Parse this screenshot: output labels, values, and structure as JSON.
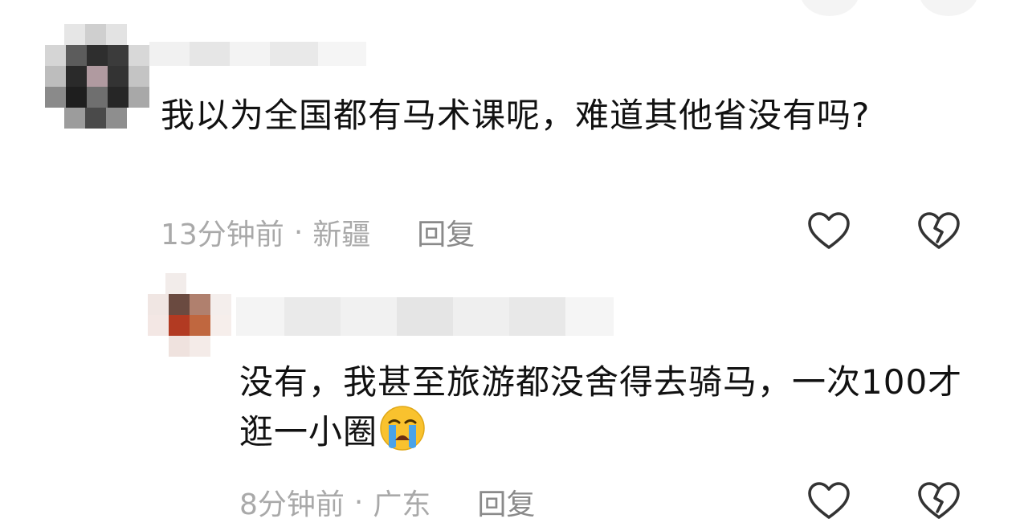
{
  "comments": [
    {
      "text": "我以为全国都有马术课呢，难道其他省没有吗?",
      "time": "13分钟前",
      "separator": "·",
      "location": "新疆",
      "reply_label": "回复",
      "like_icon": "heart-outline-icon",
      "dislike_icon": "broken-heart-icon"
    },
    {
      "text": "没有，我甚至旅游都没舍得去骑马，一次100才逛一小圈",
      "emoji": "crying-face-emoji",
      "time": "8分钟前",
      "separator": "·",
      "location": "广东",
      "reply_label": "回复",
      "like_icon": "heart-outline-icon",
      "dislike_icon": "broken-heart-icon"
    }
  ],
  "colors": {
    "text": "#111111",
    "meta": "#a9a9a9",
    "reply": "#8a8a8a",
    "icon": "#333333",
    "emoji_face": "#f9c22e",
    "emoji_tears": "#4aa3e8"
  }
}
